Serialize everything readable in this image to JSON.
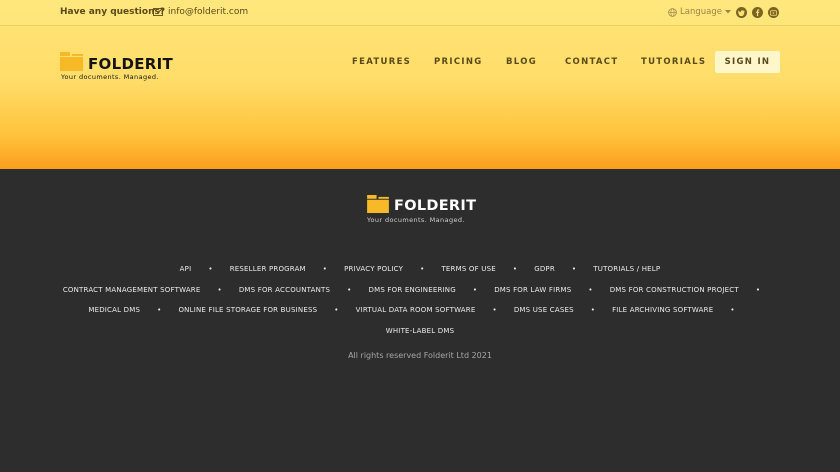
{
  "topbar": {
    "question": "Have any questions?",
    "email": "info@folderit.com",
    "language": "Language",
    "social": [
      "twitter-icon",
      "facebook-icon",
      "youtube-icon"
    ]
  },
  "brand": {
    "name": "FOLDERIT",
    "tagline": "Your documents. Managed."
  },
  "nav": {
    "features": "FEATURES",
    "pricing": "PRICING",
    "blog": "BLOG",
    "contact": "CONTACT",
    "tutorials": "TUTORIALS",
    "signin": "SIGN IN"
  },
  "footer": {
    "row1": [
      "API",
      "RESELLER PROGRAM",
      "PRIVACY POLICY",
      "TERMS OF USE",
      "GDPR",
      "TUTORIALS / HELP"
    ],
    "row2": [
      "CONTRACT MANAGEMENT SOFTWARE",
      "DMS FOR ACCOUNTANTS",
      "DMS FOR ENGINEERING",
      "DMS FOR LAW FIRMS",
      "DMS FOR CONSTRUCTION PROJECT"
    ],
    "row3": [
      "MEDICAL DMS",
      "ONLINE FILE STORAGE FOR BUSINESS",
      "VIRTUAL DATA ROOM SOFTWARE",
      "DMS USE CASES",
      "FILE ARCHIVING SOFTWARE"
    ],
    "row4": [
      "WHITE-LABEL DMS"
    ],
    "copyright": "All rights reserved Folderit Ltd 2021"
  },
  "colors": {
    "accent": "#f7b928",
    "footer_bg": "#2d2d2d",
    "nav_text": "#5a4a1a"
  }
}
